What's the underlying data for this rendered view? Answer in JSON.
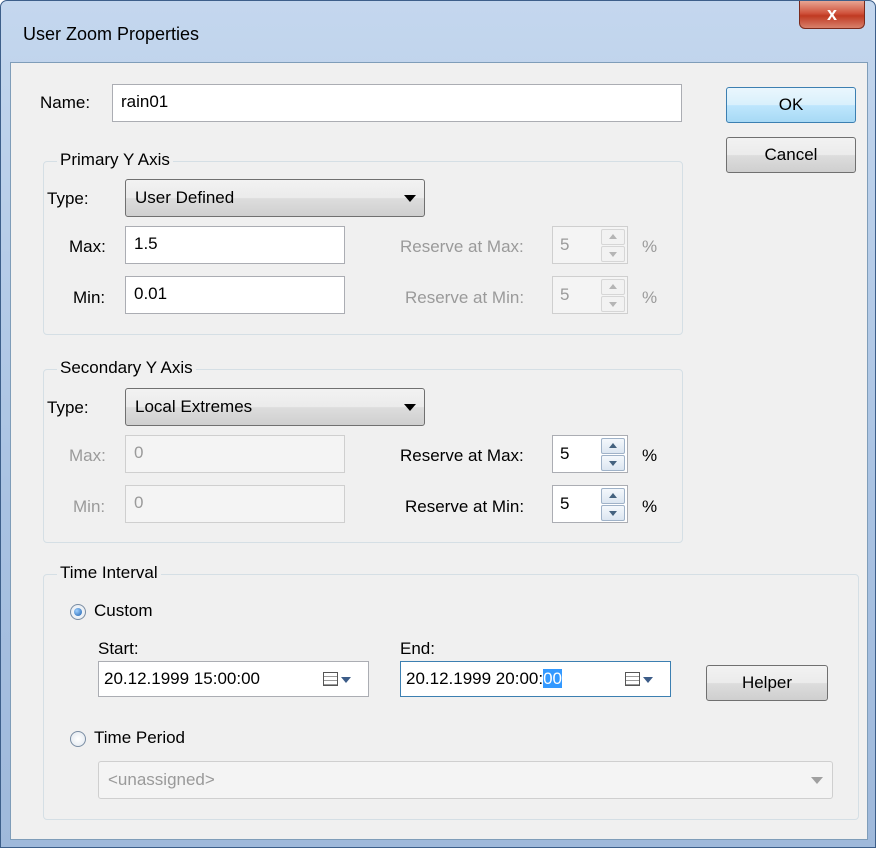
{
  "window": {
    "title": "User Zoom Properties",
    "close_glyph": "x"
  },
  "name_field": {
    "label": "Name:",
    "value": "rain01"
  },
  "buttons": {
    "ok": "OK",
    "cancel": "Cancel",
    "helper": "Helper"
  },
  "primary_axis": {
    "title": "Primary Y Axis",
    "type_label": "Type:",
    "type_value": "User Defined",
    "max_label": "Max:",
    "max_value": "1.5",
    "min_label": "Min:",
    "min_value": "0.01",
    "reserve_max_label": "Reserve at Max:",
    "reserve_max_value": "5",
    "reserve_min_label": "Reserve at Min:",
    "reserve_min_value": "5",
    "percent": "%"
  },
  "secondary_axis": {
    "title": "Secondary Y Axis",
    "type_label": "Type:",
    "type_value": "Local Extremes",
    "max_label": "Max:",
    "max_value": "0",
    "min_label": "Min:",
    "min_value": "0",
    "reserve_max_label": "Reserve at Max:",
    "reserve_max_value": "5",
    "reserve_min_label": "Reserve at Min:",
    "reserve_min_value": "5",
    "percent": "%"
  },
  "time_interval": {
    "title": "Time Interval",
    "custom_label": "Custom",
    "start_label": "Start:",
    "start_value": "20.12.1999 15:00:00",
    "end_label": "End:",
    "end_value_prefix": "20.12.1999 20:00:",
    "end_value_selected": "00",
    "time_period_label": "Time Period",
    "time_period_value": "<unassigned>",
    "selected_option": "Custom"
  }
}
